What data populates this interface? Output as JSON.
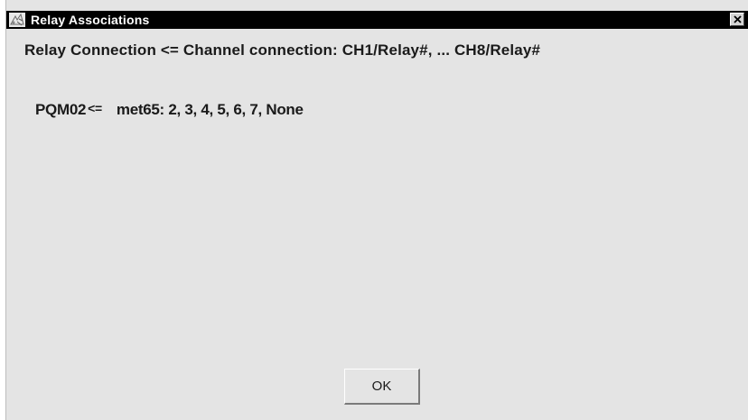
{
  "window": {
    "title": "Relay Associations",
    "close_label": "×"
  },
  "header": {
    "text": "Relay Connection <= Channel connection: CH1/Relay#, ... CH8/Relay#"
  },
  "associations": [
    {
      "device": "PQM02",
      "arrow": "<=",
      "channels": "met65: 2, 3, 4, 5, 6, 7, None"
    }
  ],
  "buttons": {
    "ok_label": "OK"
  },
  "icons": {
    "app": "app-icon",
    "close": "close-icon"
  },
  "colors": {
    "title_bar": "#000000",
    "window_bg": "#e4e4e4"
  }
}
